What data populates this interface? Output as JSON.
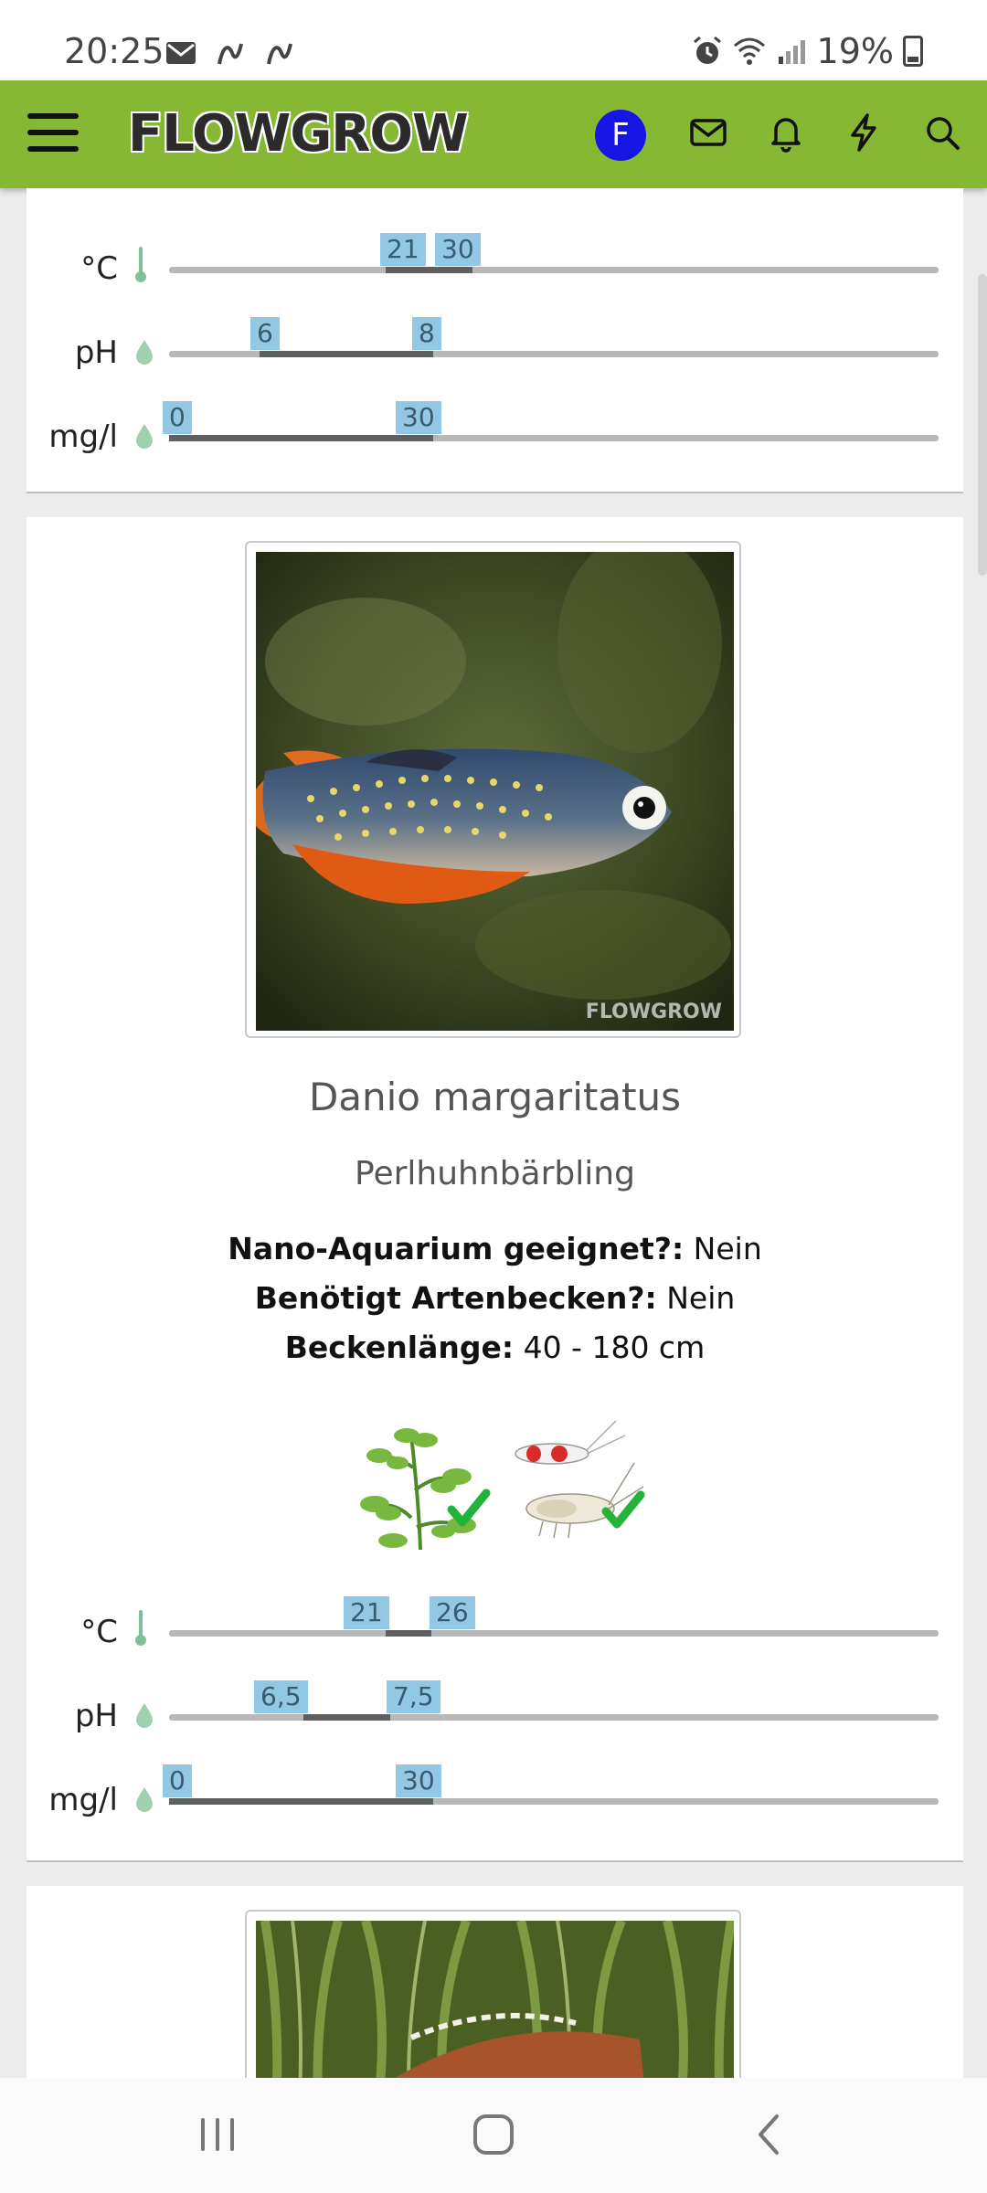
{
  "status_bar": {
    "time": "20:25",
    "battery": "19%"
  },
  "header": {
    "logo": "FLOWGROW",
    "avatar_letter": "F",
    "brand_color": "#86b834"
  },
  "card1": {
    "params": [
      {
        "label": "°C",
        "icon": "thermometer-icon",
        "min": "21",
        "max": "30"
      },
      {
        "label": "pH",
        "icon": "drop-icon",
        "min": "6",
        "max": "8"
      },
      {
        "label": "mg/l",
        "icon": "drop-icon",
        "min": "0",
        "max": "30"
      }
    ]
  },
  "card2": {
    "species": "Danio margaritatus",
    "common_name": "Perlhuhnbärbling",
    "photo_watermark": "FLOWGROW",
    "facts": [
      {
        "label": "Nano-Aquarium geeignet?:",
        "value": "Nein"
      },
      {
        "label": "Benötigt Artenbecken?:",
        "value": "Nein"
      },
      {
        "label": "Beckenlänge:",
        "value": "40 - 180 cm"
      }
    ],
    "compatibility": [
      {
        "icon": "plant-icon",
        "status": "check-icon"
      },
      {
        "icon": "shrimp-icon",
        "status": "check-icon"
      }
    ],
    "params": [
      {
        "label": "°C",
        "icon": "thermometer-icon",
        "min": "21",
        "max": "26"
      },
      {
        "label": "pH",
        "icon": "drop-icon",
        "min": "6,5",
        "max": "7,5"
      },
      {
        "label": "mg/l",
        "icon": "drop-icon",
        "min": "0",
        "max": "30"
      }
    ]
  }
}
